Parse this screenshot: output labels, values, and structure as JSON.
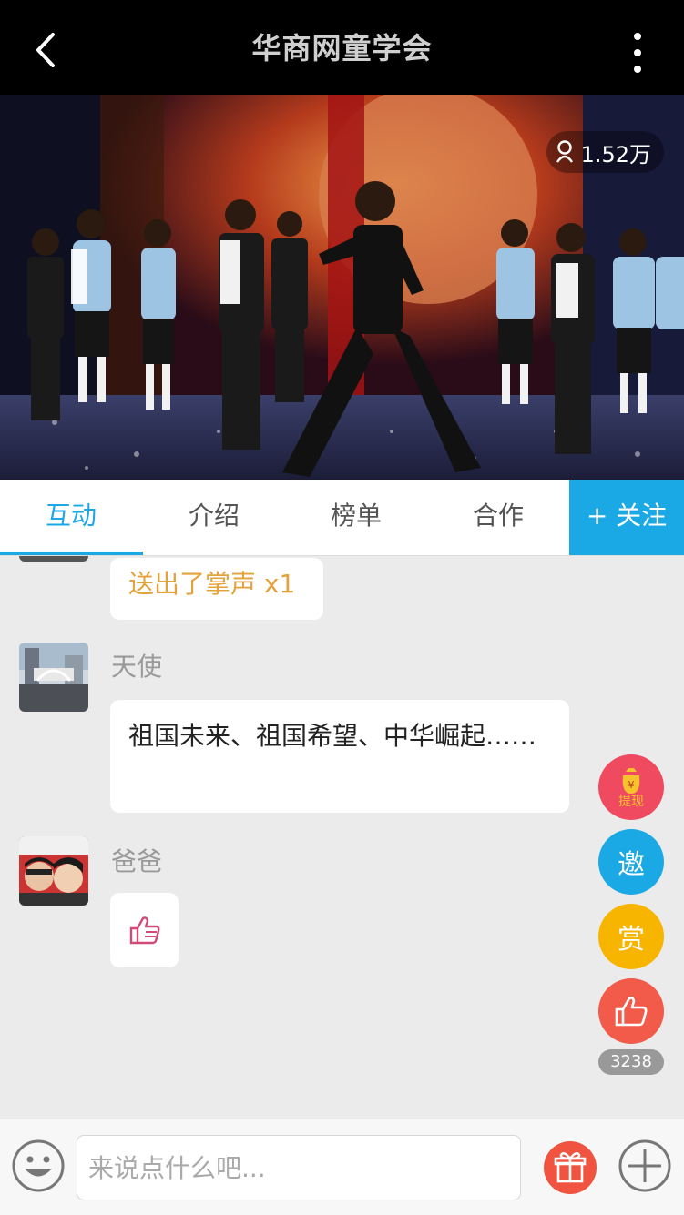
{
  "header": {
    "title": "华商网童学会"
  },
  "video": {
    "viewer_count": "1.52万"
  },
  "tabs": [
    {
      "label": "互动",
      "active": true
    },
    {
      "label": "介绍"
    },
    {
      "label": "榜单"
    },
    {
      "label": "合作"
    }
  ],
  "follow_label": "+ 关注",
  "chat": {
    "messages": [
      {
        "text": "送出了掌声 x1"
      },
      {
        "user": "天使",
        "text": "祖国未来、祖国希望、中华崛起……"
      },
      {
        "user": "爸爸",
        "icon": "thumbs-up-icon"
      }
    ]
  },
  "side": {
    "withdraw_label": "提现",
    "invite_label": "邀",
    "reward_label": "赏",
    "like_count": "3238"
  },
  "input": {
    "placeholder": "来说点什么吧..."
  },
  "colors": {
    "accent": "#1ba9e6",
    "gift_text": "#e4a23a",
    "withdraw": "#ef4a5f",
    "invite": "#1ba9e6",
    "reward": "#f7b500",
    "like": "#f25a4a"
  }
}
